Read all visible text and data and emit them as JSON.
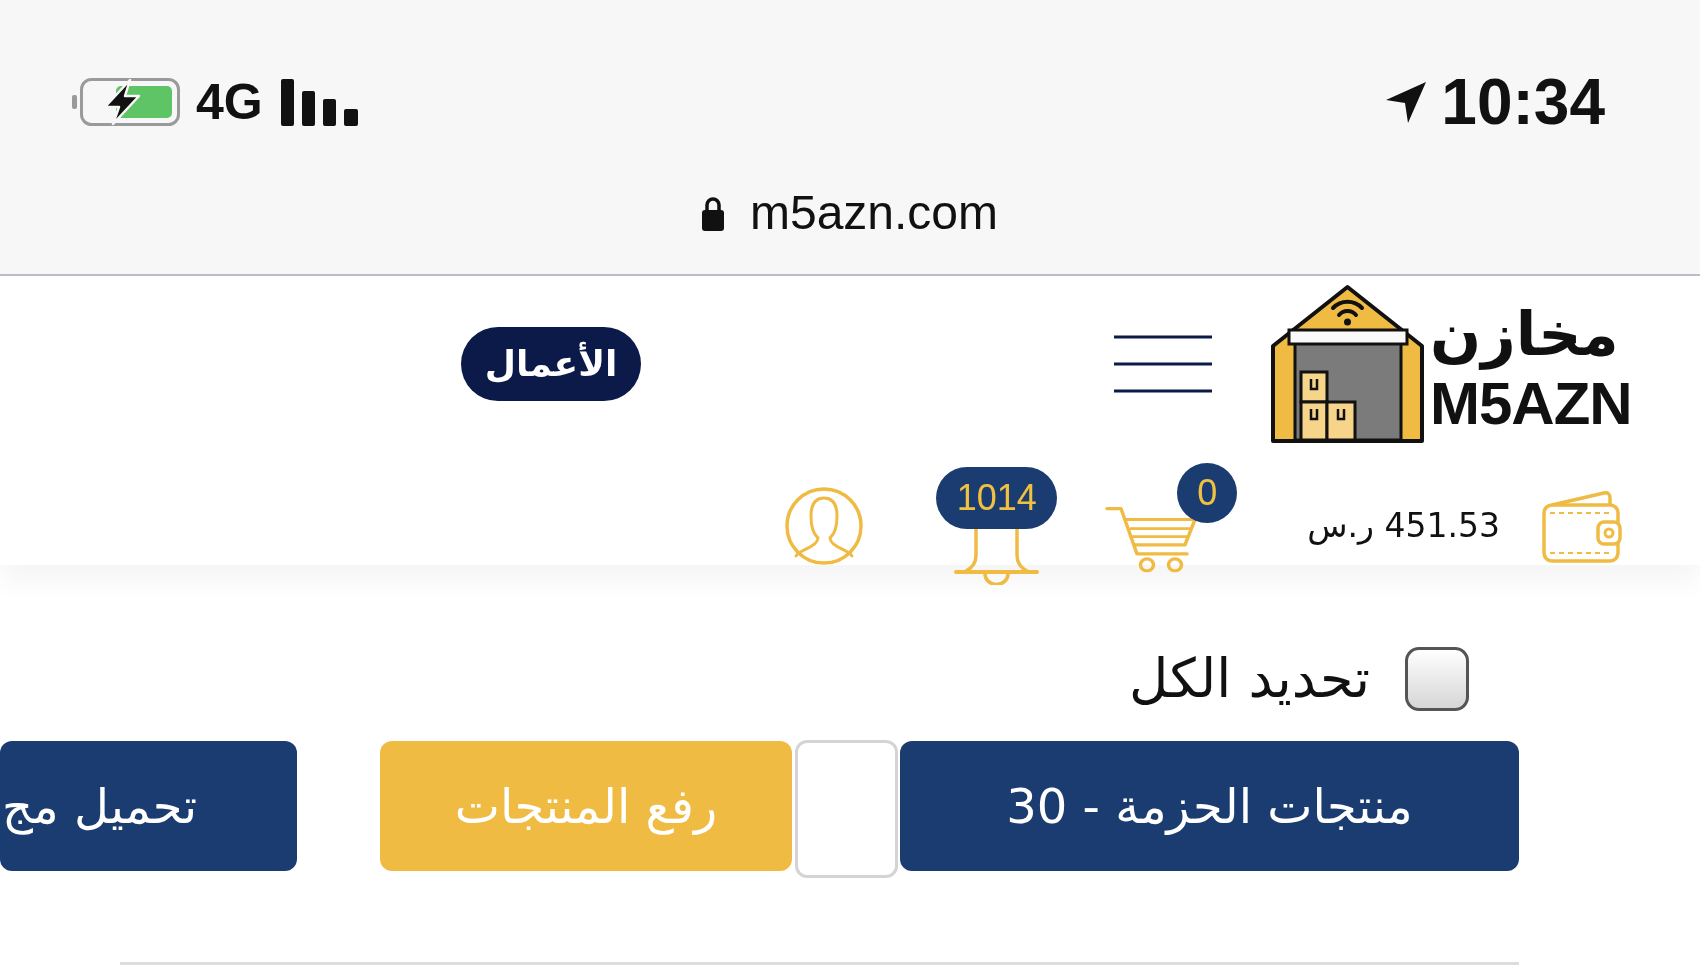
{
  "status_bar": {
    "network": "4G",
    "time": "10:34"
  },
  "address_bar": {
    "url": "m5azn.com"
  },
  "header": {
    "logo": {
      "name_arabic": "مخازن",
      "name_latin": "M5AZN"
    },
    "business_button": {
      "label": "الأعمال"
    },
    "wallet": {
      "balance": "451.53 ر.س"
    },
    "cart": {
      "count": "0"
    },
    "notifications": {
      "count": "1014"
    }
  },
  "select_all": {
    "label": "تحديد الكل",
    "checked": false
  },
  "actions": [
    {
      "kind": "primary",
      "label": "منتجات الحزمة - 30"
    },
    {
      "kind": "field"
    },
    {
      "kind": "accent",
      "label": "رفع المنتجات"
    },
    {
      "kind": "primary",
      "label": "تحميل مج"
    }
  ]
}
